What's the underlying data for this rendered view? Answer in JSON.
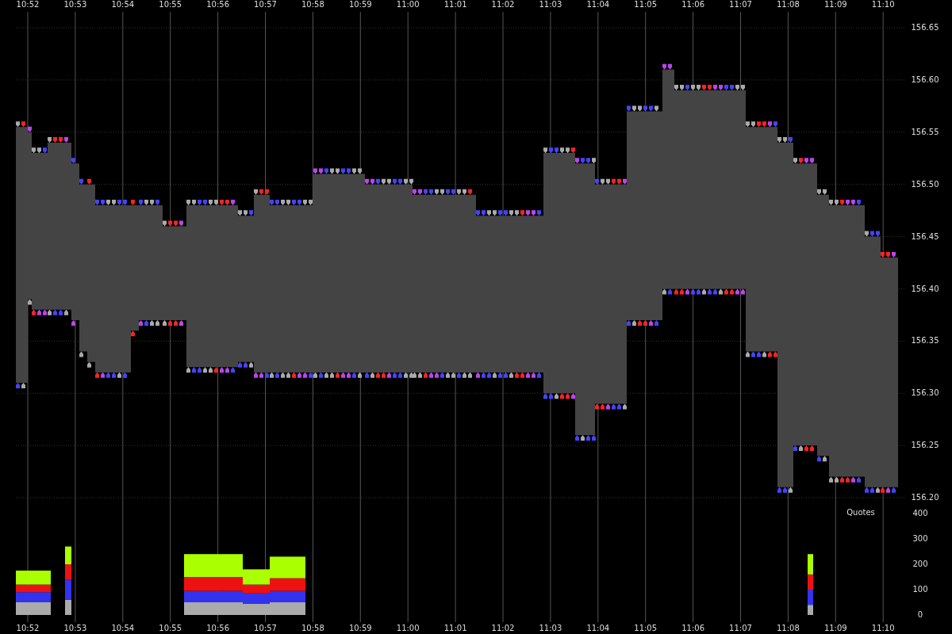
{
  "chart": {
    "time_labels_top": [
      "10:52",
      "10:53",
      "10:54",
      "10:55",
      "10:56",
      "10:57",
      "10:58",
      "10:59",
      "11:00",
      "11:01",
      "11:02",
      "11:03",
      "11:04",
      "11:05",
      "11:06",
      "11:07",
      "11:08",
      "11:09",
      "11:10"
    ],
    "time_labels_bottom": [
      "10:52",
      "10:53",
      "10:54",
      "10:55",
      "10:56",
      "10:57",
      "10:58",
      "10:59",
      "11:00",
      "11:01",
      "11:02",
      "11:03",
      "11:04",
      "11:05",
      "11:06",
      "11:07",
      "11:08",
      "11:09",
      "11:10"
    ],
    "price_labels": [
      "156.65",
      "156.60",
      "156.55",
      "156.50",
      "156.45",
      "156.40",
      "156.35",
      "156.30",
      "156.25",
      "156.20"
    ],
    "volume_title": "Quotes",
    "volume_labels": [
      "400",
      "300",
      "200",
      "100",
      "0"
    ]
  }
}
